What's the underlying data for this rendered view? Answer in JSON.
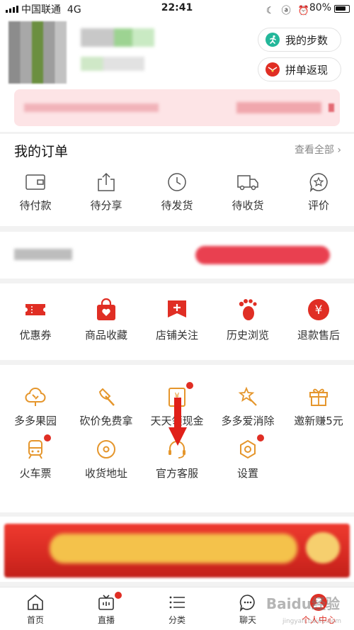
{
  "status_bar": {
    "carrier": "中国联通",
    "network": "4G",
    "time": "22:41",
    "battery": "80%",
    "battery_level": 0.8
  },
  "header": {
    "steps_button": "我的步数",
    "cashback_button": "拼单返现"
  },
  "orders": {
    "title": "我的订单",
    "view_all": "查看全部",
    "items": [
      {
        "label": "待付款",
        "icon": "wallet-icon"
      },
      {
        "label": "待分享",
        "icon": "share-icon"
      },
      {
        "label": "待发货",
        "icon": "clock-icon"
      },
      {
        "label": "待收货",
        "icon": "truck-icon"
      },
      {
        "label": "评价",
        "icon": "star-comment-icon"
      }
    ]
  },
  "services": {
    "items": [
      {
        "label": "优惠券",
        "icon": "coupon-icon"
      },
      {
        "label": "商品收藏",
        "icon": "favorite-bag-icon"
      },
      {
        "label": "店铺关注",
        "icon": "shop-follow-icon"
      },
      {
        "label": "历史浏览",
        "icon": "footprint-icon"
      },
      {
        "label": "退款售后",
        "icon": "refund-icon"
      }
    ]
  },
  "tools": {
    "row1": [
      {
        "label": "多多果园",
        "icon": "tree-icon"
      },
      {
        "label": "砍价免费拿",
        "icon": "axe-icon"
      },
      {
        "label": "天天领现金",
        "icon": "cash-envelope-icon"
      },
      {
        "label": "多多爱消除",
        "icon": "star-wand-icon"
      },
      {
        "label": "邀新赚5元",
        "icon": "gift-icon"
      }
    ],
    "row2": [
      {
        "label": "火车票",
        "icon": "train-icon"
      },
      {
        "label": "收货地址",
        "icon": "location-icon"
      },
      {
        "label": "官方客服",
        "icon": "headset-icon"
      },
      {
        "label": "设置",
        "icon": "settings-icon"
      }
    ]
  },
  "tabbar": {
    "items": [
      {
        "label": "首页",
        "icon": "home-icon"
      },
      {
        "label": "直播",
        "icon": "tv-icon"
      },
      {
        "label": "分类",
        "icon": "list-icon"
      },
      {
        "label": "聊天",
        "icon": "chat-icon"
      },
      {
        "label": "个人中心",
        "icon": "profile-icon"
      }
    ]
  },
  "watermark": {
    "text": "Baidu经验",
    "sub": "jingyan.baidu.com"
  },
  "colors": {
    "brand_red": "#e02e24",
    "tool_orange": "#e5962c",
    "steps_green": "#23b79a"
  }
}
